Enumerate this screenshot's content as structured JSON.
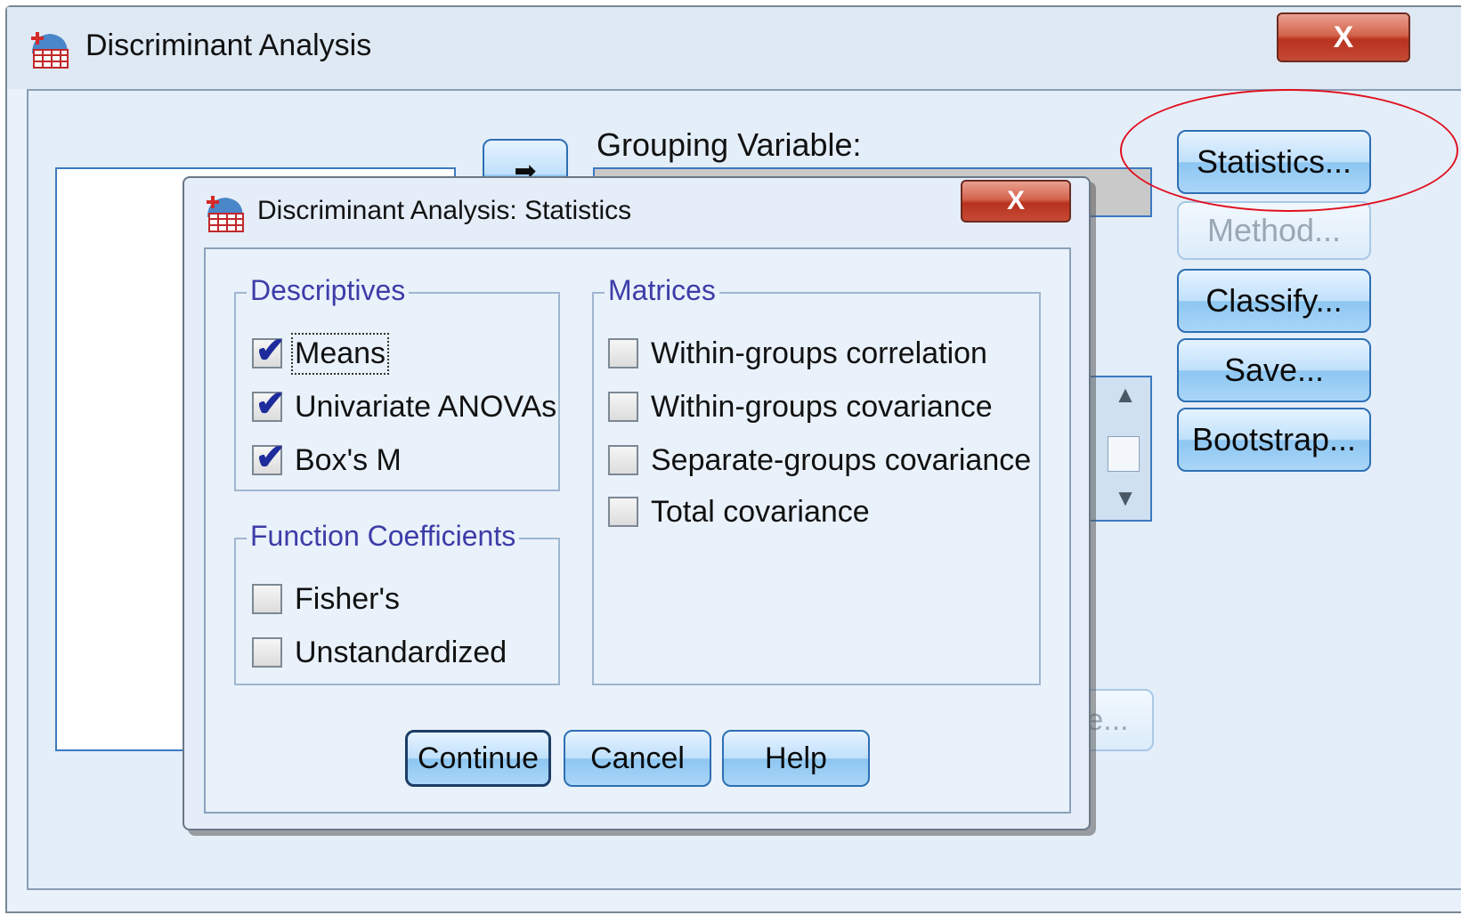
{
  "outer_window": {
    "title": "Discriminant Analysis",
    "close_label": "X",
    "grouping_label": "Grouping Variable:",
    "buttons": {
      "statistics": "Statistics...",
      "method": "Method...",
      "classify": "Classify...",
      "save": "Save...",
      "bootstrap": "Bootstrap...",
      "partial_hidden": "e..."
    },
    "highlight_color": "#e0101e"
  },
  "dialog": {
    "title": "Discriminant Analysis: Statistics",
    "close_label": "X",
    "descriptives": {
      "title": "Descriptives",
      "items": [
        {
          "label": "Means",
          "checked": true
        },
        {
          "label": "Univariate ANOVAs",
          "checked": true
        },
        {
          "label": "Box's M",
          "checked": true
        }
      ]
    },
    "function_coefficients": {
      "title": "Function Coefficients",
      "items": [
        {
          "label": "Fisher's",
          "checked": false
        },
        {
          "label": "Unstandardized",
          "checked": false
        }
      ]
    },
    "matrices": {
      "title": "Matrices",
      "items": [
        {
          "label": "Within-groups correlation",
          "checked": false
        },
        {
          "label": "Within-groups covariance",
          "checked": false
        },
        {
          "label": "Separate-groups covariance",
          "checked": false
        },
        {
          "label": "Total covariance",
          "checked": false
        }
      ]
    },
    "buttons": {
      "continue": "Continue",
      "cancel": "Cancel",
      "help": "Help"
    },
    "check_mark": "✔"
  },
  "icons": {
    "app": "spss-app-icon",
    "close": "close-icon"
  }
}
